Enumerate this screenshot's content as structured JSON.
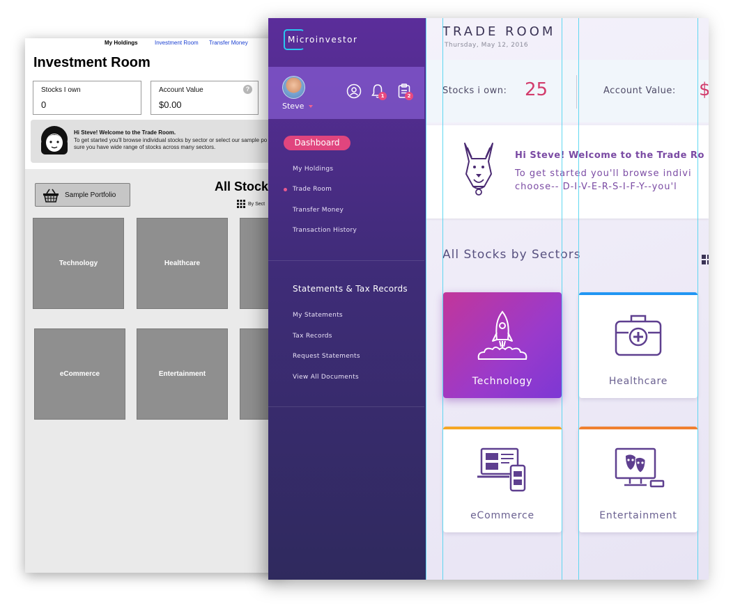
{
  "wireframe": {
    "nav": [
      "My Holdings",
      "Investment Room",
      "Transfer Money"
    ],
    "title": "Investment Room",
    "stocks_label": "Stocks I own",
    "stocks_value": "0",
    "account_label": "Account Value",
    "account_value": "$0.00",
    "help_glyph": "?",
    "welcome_title": "Hi Steve! Welcome to the Trade Room.",
    "welcome_line1": "To get started you'll browse individual stocks by sector or select our sample po",
    "welcome_line2": "sure you have wide range of stocks across many sectors.",
    "sample_button": "Sample Portfolio",
    "all_stocks": "All Stock",
    "by_sector": "By Sect",
    "tiles": [
      "Technology",
      "Healthcare",
      "eCommerce",
      "Entertainment"
    ]
  },
  "app": {
    "logo": "Microinvestor",
    "user": {
      "name": "Steve",
      "notification_count": "1",
      "clipboard_count": "2"
    },
    "sidebar": {
      "dashboard": "Dashboard",
      "items": [
        "My Holdings",
        "Trade Room",
        "Transfer Money",
        "Transaction History"
      ],
      "active_item": "Trade Room",
      "section_title": "Statements & Tax Records",
      "section_items": [
        "My Statements",
        "Tax Records",
        "Request Statements",
        "View All Documents"
      ]
    },
    "header": {
      "title": "TRADE ROOM",
      "date": "Thursday, May 12, 2016"
    },
    "stats": {
      "stocks_label": "Stocks i own:",
      "stocks_value": "25",
      "account_label": "Account Value:",
      "account_value": "$"
    },
    "welcome": {
      "title": "Hi Steve! Welcome to the Trade Ro",
      "line1": "To get started you'll browse indivi",
      "line2": "choose-- D-I-V-E-R-S-I-F-Y--you'l"
    },
    "section_title": "All Stocks by Sectors",
    "sectors": [
      {
        "label": "Technology",
        "icon": "rocket-icon",
        "accent": "#9a3acb"
      },
      {
        "label": "Healthcare",
        "icon": "medical-kit-icon",
        "accent": "#2196f3"
      },
      {
        "label": "eCommerce",
        "icon": "devices-icon",
        "accent": "#f5a623"
      },
      {
        "label": "Entertainment",
        "icon": "theater-masks-icon",
        "accent": "#f08030"
      }
    ]
  },
  "colors": {
    "accent_pink": "#e0457e",
    "sidebar_top": "#5b2d9a",
    "guide_cyan": "#4fd4f0",
    "value_pink": "#d23c6c"
  }
}
